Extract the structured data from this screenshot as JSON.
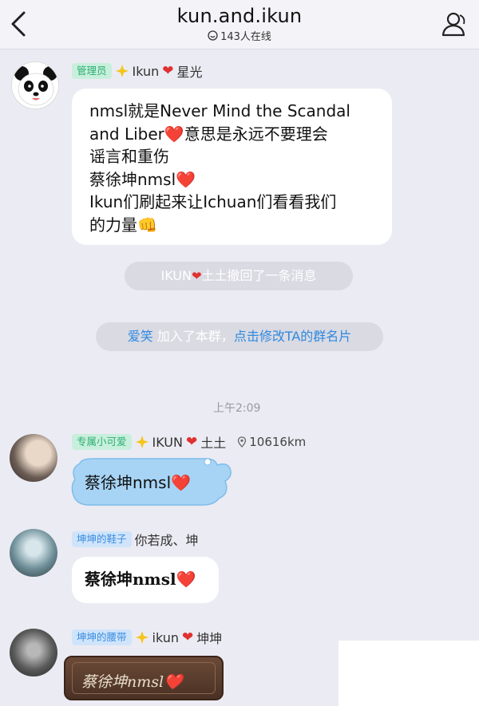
{
  "header": {
    "title": "kun.and.ikun",
    "online_count": "143人在线",
    "back_icon": "chevron-left-icon",
    "profile_icon": "group-profile-icon"
  },
  "messages": [
    {
      "tag": "管理员",
      "nickname_prefix": "Ikun",
      "nickname_suffix": "星光",
      "avatar_icon": "panda-avatar",
      "lines": [
        "nmsl就是Never Mind the Scandal",
        "and Liber❤️意思是永远不要理会",
        "谣言和重伤",
        "蔡徐坤nmsl❤️",
        "Ikun们刷起来让Ichuan们看看我们",
        "的力量👊"
      ]
    },
    {
      "tag": "专属小可爱",
      "nickname_prefix": "IKUN",
      "nickname_suffix": "土土",
      "distance": "10616km",
      "text": "蔡徐坤nmsl❤️"
    },
    {
      "tag": "坤坤的鞋子",
      "nickname": "你若成、坤",
      "text": "蔡徐坤nmsl❤️"
    },
    {
      "tag": "坤坤的腰带",
      "nickname_prefix": "ikun",
      "nickname_suffix": "坤坤",
      "text": "蔡徐坤nmsl❤️"
    }
  ],
  "system": {
    "recall_prefix": "IKUN",
    "recall_suffix": "土土撤回了一条消息",
    "join_name": "爱笑",
    "join_text": " 加入了本群，",
    "join_link": "点击修改TA的群名片",
    "time": "上午2:09"
  },
  "colors": {
    "background": "#ebebf3",
    "accent_blue": "#2f89e0",
    "tag_green": "#2eae74",
    "heart": "#e03131"
  }
}
